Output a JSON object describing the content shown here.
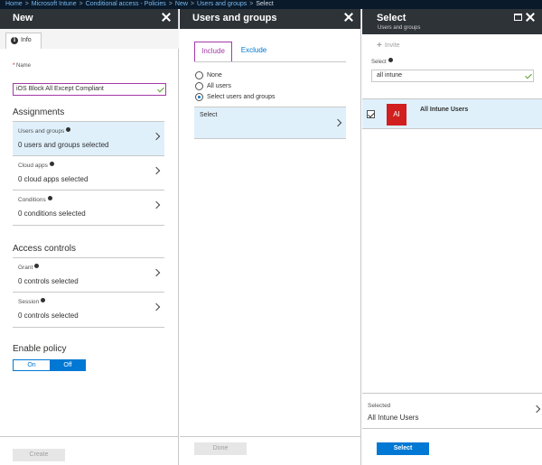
{
  "breadcrumb": [
    "Home",
    "Microsoft Intune",
    "Conditional access - Policies",
    "New",
    "Users and groups",
    "Select"
  ],
  "blade_new": {
    "title": "New",
    "info_tab": "Info",
    "name_label": "Name",
    "name_value": "iOS Block All Except Compliant",
    "assignments_heading": "Assignments",
    "rows": [
      {
        "label": "Users and groups",
        "value": "0 users and groups selected"
      },
      {
        "label": "Cloud apps",
        "value": "0 cloud apps selected"
      },
      {
        "label": "Conditions",
        "value": "0 conditions selected"
      }
    ],
    "access_heading": "Access controls",
    "access_rows": [
      {
        "label": "Grant",
        "value": "0 controls selected"
      },
      {
        "label": "Session",
        "value": "0 controls selected"
      }
    ],
    "enable_heading": "Enable policy",
    "toggle_on": "On",
    "toggle_off": "Off",
    "create_label": "Create"
  },
  "blade_users": {
    "title": "Users and groups",
    "include_tab": "Include",
    "exclude_tab": "Exclude",
    "options": [
      "None",
      "All users",
      "Select users and groups"
    ],
    "selected_option": "Select users and groups",
    "select_label": "Select",
    "done_label": "Done"
  },
  "blade_select": {
    "title": "Select",
    "subtitle": "Users and groups",
    "invite_label": "Invite",
    "select_label": "Select",
    "search_value": "all intune",
    "result": {
      "initials": "AI",
      "name": "All Intune Users"
    },
    "selected_label": "Selected",
    "selected_value": "All Intune Users",
    "select_button": "Select"
  },
  "colors": {
    "accent": "#0078d4",
    "highlight": "#dff0fb",
    "avatar": "#d11e1e",
    "focus": "#a33aa7"
  }
}
